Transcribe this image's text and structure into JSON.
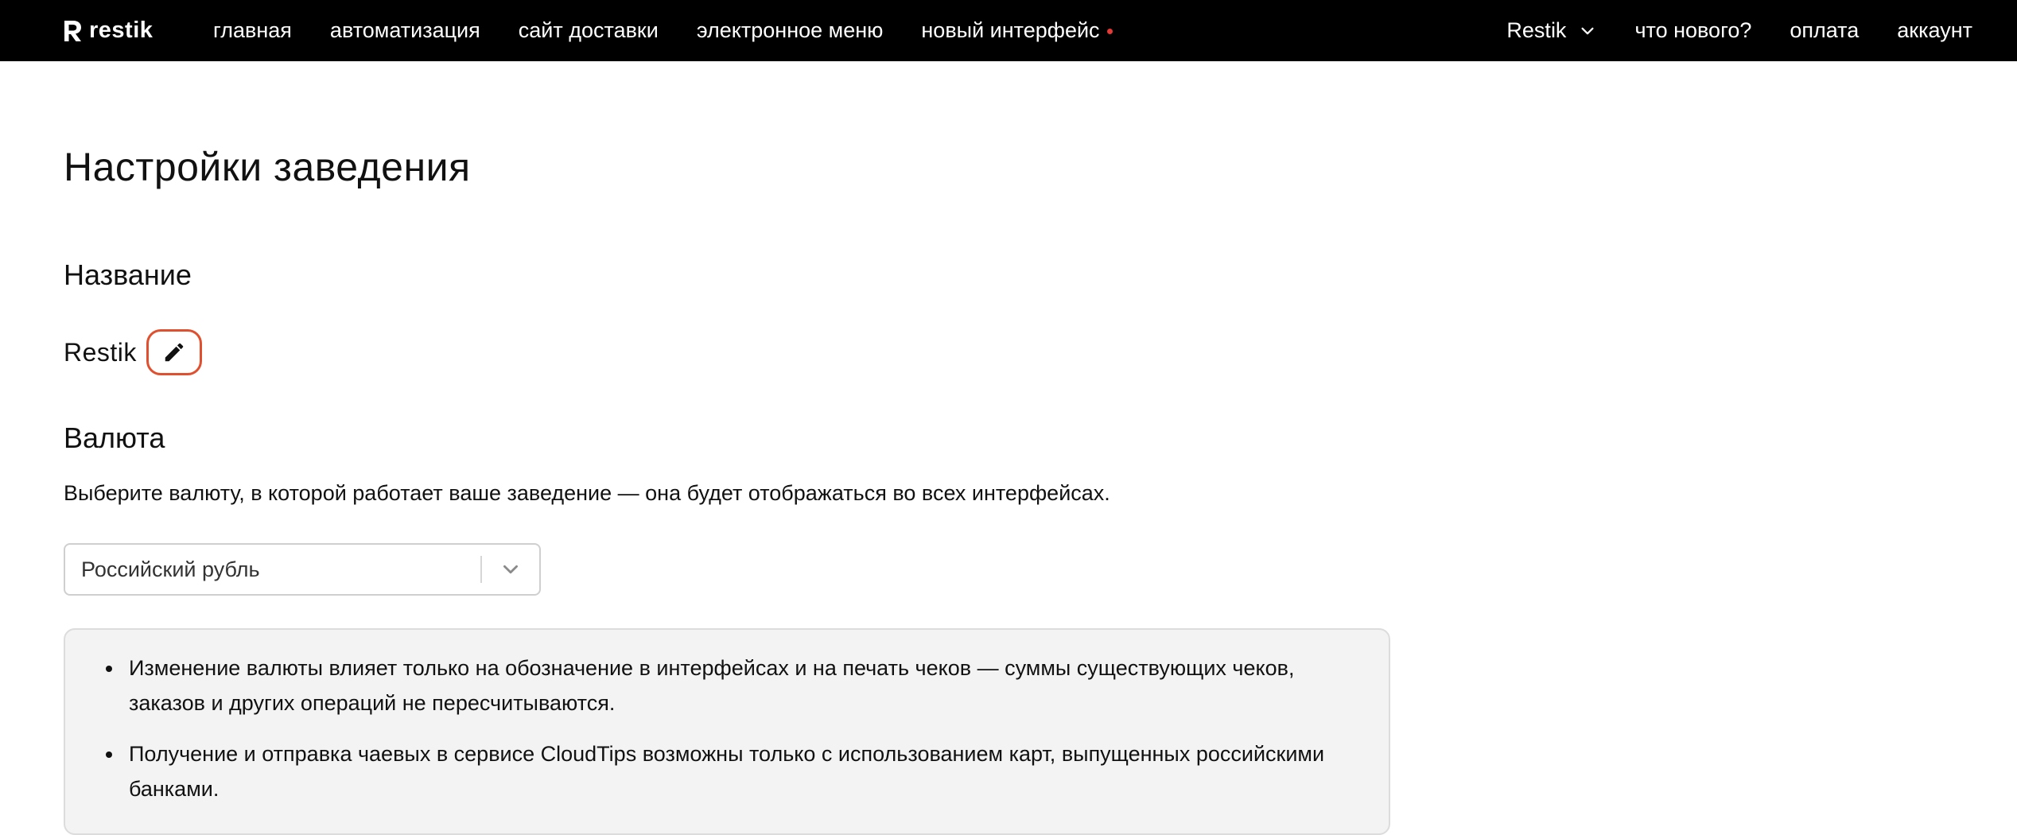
{
  "topbar": {
    "logo_text": "restik",
    "nav_left": [
      {
        "label": "главная"
      },
      {
        "label": "автоматизация"
      },
      {
        "label": "сайт доставки"
      },
      {
        "label": "электронное меню"
      },
      {
        "label": "новый интерфейс",
        "badge_color": "#e53935"
      }
    ],
    "venue_switcher": "Restik",
    "nav_right": [
      {
        "label": "что нового?"
      },
      {
        "label": "оплата"
      },
      {
        "label": "аккаунт"
      }
    ]
  },
  "page": {
    "title": "Настройки заведения"
  },
  "name_section": {
    "heading": "Название",
    "value": "Restik",
    "edit_icon": "pencil-icon",
    "edit_border_color": "#e0502f"
  },
  "currency_section": {
    "heading": "Валюта",
    "description": "Выберите валюту, в которой работает ваше заведение — она будет отображаться во всех интерфейсах.",
    "selected": "Российский рубль",
    "dropdown_icon": "chevron-down-icon",
    "notes": [
      "Изменение валюты влияет только на обозначение в интерфейсах и на печать чеков — суммы существующих чеков, заказов и других операций не пересчитываются.",
      "Получение и отправка чаевых в сервисе CloudTips возможны только с использованием карт, выпущенных российскими банками."
    ]
  },
  "colors": {
    "topbar_bg": "#000000",
    "accent_red": "#e53935",
    "notice_bg": "#f3f3f3"
  }
}
